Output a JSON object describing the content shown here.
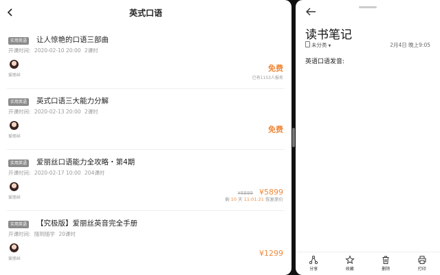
{
  "left_pane": {
    "header": {
      "title": "英式口语"
    },
    "courses": [
      {
        "tag": "实用英语",
        "title": "让人惊艳的口语三部曲",
        "time_label": "开课时间:",
        "datetime": "2020-02-10 20:00",
        "lessons": "2课时",
        "teacher": "爱丽丝",
        "price": "免费",
        "enrolled": "已有1153人报名"
      },
      {
        "tag": "实用英语",
        "title": "英式口语三大能力分解",
        "time_label": "开课时间:",
        "datetime": "2020-02-13 20:00",
        "lessons": "2课时",
        "teacher": "爱丽丝",
        "price": "免费"
      },
      {
        "tag": "实用英语",
        "title": "爱丽丝口语能力全攻略・第4期",
        "time_label": "开课时间:",
        "datetime": "2020-02-17 10:00",
        "lessons": "204课时",
        "teacher": "爱丽丝",
        "original_price": "¥6899",
        "price": "¥5899",
        "countdown": {
          "prefix": "剩",
          "days": "10",
          "days_unit": "天",
          "time": "11:01:21",
          "suffix": "恢复原价"
        }
      },
      {
        "tag": "实用英语",
        "title": "【究极版】爱丽丝英音完全手册",
        "time_label": "开课时间:",
        "datetime": "随到随学",
        "lessons": "20课时",
        "teacher": "爱丽丝",
        "price": "¥1299"
      }
    ]
  },
  "right_pane": {
    "title": "读书笔记",
    "category": "未分类",
    "date": "2月4日 晚上9:05",
    "body": "英语口语发音:",
    "toolbar": [
      {
        "icon": "share-icon",
        "label": "分享"
      },
      {
        "icon": "star-icon",
        "label": "收藏"
      },
      {
        "icon": "trash-icon",
        "label": "删除"
      },
      {
        "icon": "printer-icon",
        "label": "打印"
      }
    ]
  },
  "colors": {
    "accent": "#f0883a",
    "tag_bg": "#8a8a8a"
  }
}
